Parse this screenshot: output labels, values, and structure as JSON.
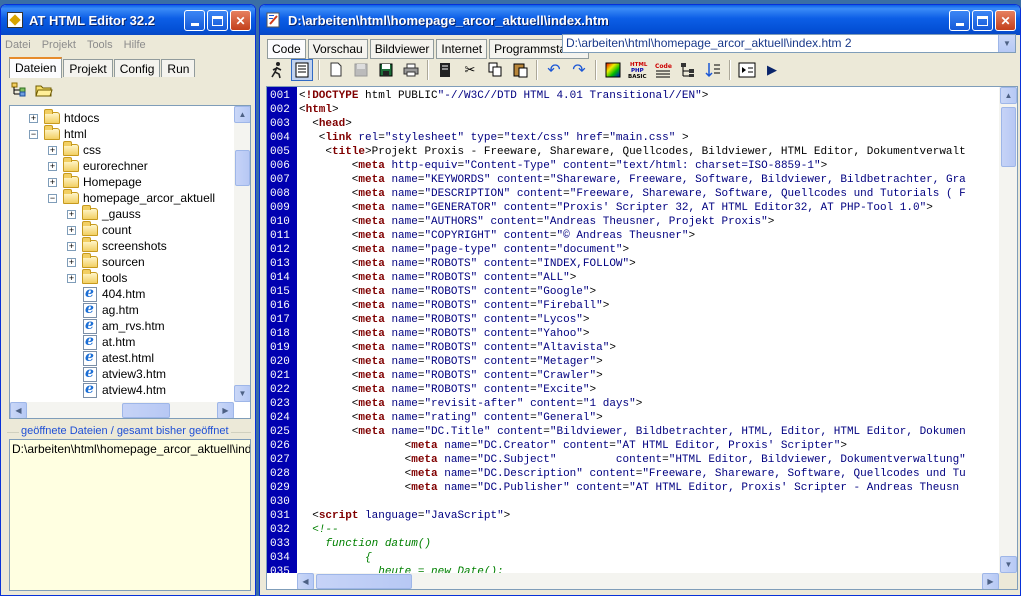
{
  "left_window": {
    "title": "AT HTML Editor 32.2",
    "menu": [
      "Datei",
      "Projekt",
      "Tools",
      "Hilfe"
    ],
    "tabs": [
      "Dateien",
      "Projekt",
      "Config",
      "Run"
    ],
    "tree": [
      {
        "label": "htdocs",
        "type": "folder",
        "indent": 1,
        "expander": "+"
      },
      {
        "label": "html",
        "type": "folder",
        "indent": 1,
        "expander": "−"
      },
      {
        "label": "css",
        "type": "folder",
        "indent": 2,
        "expander": "+"
      },
      {
        "label": "eurorechner",
        "type": "folder",
        "indent": 2,
        "expander": "+"
      },
      {
        "label": "Homepage",
        "type": "folder",
        "indent": 2,
        "expander": "+"
      },
      {
        "label": "homepage_arcor_aktuell",
        "type": "folder",
        "indent": 2,
        "expander": "−"
      },
      {
        "label": "_gauss",
        "type": "folder",
        "indent": 3,
        "expander": "+"
      },
      {
        "label": "count",
        "type": "folder",
        "indent": 3,
        "expander": "+"
      },
      {
        "label": "screenshots",
        "type": "folder",
        "indent": 3,
        "expander": "+"
      },
      {
        "label": "sourcen",
        "type": "folder",
        "indent": 3,
        "expander": "+"
      },
      {
        "label": "tools",
        "type": "folder",
        "indent": 3,
        "expander": "+"
      },
      {
        "label": "404.htm",
        "type": "file",
        "indent": 3,
        "expander": ""
      },
      {
        "label": "ag.htm",
        "type": "file",
        "indent": 3,
        "expander": ""
      },
      {
        "label": "am_rvs.htm",
        "type": "file",
        "indent": 3,
        "expander": ""
      },
      {
        "label": "at.htm",
        "type": "file",
        "indent": 3,
        "expander": ""
      },
      {
        "label": "atest.html",
        "type": "file",
        "indent": 3,
        "expander": ""
      },
      {
        "label": "atview3.htm",
        "type": "file",
        "indent": 3,
        "expander": ""
      },
      {
        "label": "atview4.htm",
        "type": "file",
        "indent": 3,
        "expander": ""
      }
    ],
    "open_files_label": "geöffnete Dateien / gesamt bisher geöffnet",
    "open_files": [
      "D:\\arbeiten\\html\\homepage_arcor_aktuell\\index.htm"
    ]
  },
  "main_window": {
    "title": "D:\\arbeiten\\html\\homepage_arcor_aktuell\\index.htm",
    "tabs": [
      "Code",
      "Vorschau",
      "Bildviewer",
      "Internet",
      "Programmstarter"
    ],
    "path_combo": "D:\\arbeiten\\html\\homepage_arcor_aktuell\\index.htm 2",
    "toolbar_icons": [
      "run-icon",
      "view-icon",
      "new-file-icon",
      "save-disabled-icon",
      "save-icon",
      "print-icon",
      "notebook-icon",
      "cut-icon",
      "copy-icon",
      "paste-icon",
      "undo-icon",
      "redo-icon",
      "color-icon",
      "html-php-basic-icon",
      "code-icon",
      "tree-icon",
      "sort-icon",
      "preview-icon",
      "play-icon"
    ],
    "line_numbers": [
      "001",
      "002",
      "003",
      "004",
      "005",
      "006",
      "007",
      "008",
      "009",
      "010",
      "011",
      "012",
      "013",
      "014",
      "015",
      "016",
      "017",
      "018",
      "019",
      "020",
      "021",
      "022",
      "023",
      "024",
      "025",
      "026",
      "027",
      "028",
      "029",
      "030",
      "031",
      "032",
      "033",
      "034",
      "035"
    ],
    "code_lines": [
      "<!DOCTYPE html PUBLIC\"-//W3C//DTD HTML 4.01 Transitional//EN\">",
      "<html>",
      "  <head>",
      "   <link rel=\"stylesheet\" type=\"text/css\" href=\"main.css\" >",
      "    <title>Projekt Proxis - Freeware, Shareware, Quellcodes, Bildviewer, HTML Editor, Dokumentverwalt",
      "        <meta http-equiv=\"Content-Type\" content=\"text/html: charset=ISO-8859-1\">",
      "        <meta name=\"KEYWORDS\" content=\"Shareware, Freeware, Software, Bildviewer, Bildbetrachter, Gra",
      "        <meta name=\"DESCRIPTION\" content=\"Freeware, Shareware, Software, Quellcodes und Tutorials ( F",
      "        <meta name=\"GENERATOR\" content=\"Proxis' Scripter 32, AT HTML Editor32, AT PHP-Tool 1.0\">",
      "        <meta name=\"AUTHORS\" content=\"Andreas Theusner, Projekt Proxis\">",
      "        <meta name=\"COPYRIGHT\" content=\"© Andreas Theusner\">",
      "        <meta name=\"page-type\" content=\"document\">",
      "        <meta name=\"ROBOTS\" content=\"INDEX,FOLLOW\">",
      "        <meta name=\"ROBOTS\" content=\"ALL\">",
      "        <meta name=\"ROBOTS\" content=\"Google\">",
      "        <meta name=\"ROBOTS\" content=\"Fireball\">",
      "        <meta name=\"ROBOTS\" content=\"Lycos\">",
      "        <meta name=\"ROBOTS\" content=\"Yahoo\">",
      "        <meta name=\"ROBOTS\" content=\"Altavista\">",
      "        <meta name=\"ROBOTS\" content=\"Metager\">",
      "        <meta name=\"ROBOTS\" content=\"Crawler\">",
      "        <meta name=\"ROBOTS\" content=\"Excite\">",
      "        <meta name=\"revisit-after\" content=\"1 days\">",
      "        <meta name=\"rating\" content=\"General\">",
      "        <meta name=\"DC.Title\" content=\"Bildviewer, Bildbetrachter, HTML, Editor, HTML Editor, Dokumen",
      "                <meta name=\"DC.Creator\" content=\"AT HTML Editor, Proxis' Scripter\">",
      "                <meta name=\"DC.Subject\"         content=\"HTML Editor, Bildviewer, Dokumentverwaltung\"",
      "                <meta name=\"DC.Description\" content=\"Freeware, Shareware, Software, Quellcodes und Tu",
      "                <meta name=\"DC.Publisher\" content=\"AT HTML Editor, Proxis' Scripter - Andreas Theusn",
      "",
      "  <script language=\"JavaScript\">",
      "  <!--",
      "    function datum()",
      "          {",
      "            heute = new Date();"
    ]
  }
}
